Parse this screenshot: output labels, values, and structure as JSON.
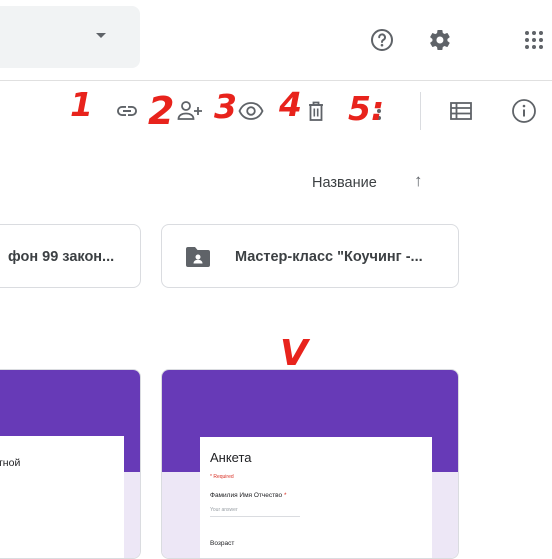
{
  "header": {
    "help_icon": "help-circle-icon",
    "settings_icon": "gear-icon",
    "apps_icon": "apps-grid-icon"
  },
  "toolbar": {
    "link_icon": "link-icon",
    "add_person_icon": "person-add-icon",
    "preview_icon": "eye-icon",
    "delete_icon": "trash-icon",
    "more_icon": "more-vert-icon",
    "list_view_icon": "list-view-icon",
    "info_icon": "info-icon"
  },
  "annotations": [
    "1",
    "2",
    "3",
    "4",
    "5:",
    "V"
  ],
  "sort": {
    "label": "Название",
    "arrow": "↑"
  },
  "folders": [
    {
      "title": "фон 99 закон..."
    },
    {
      "title": "Мастер-класс \"Коучинг -..."
    }
  ],
  "forms": [
    {
      "snippet": "тной"
    },
    {
      "title": "Анкета",
      "required_note": "* Required",
      "question": "Фамилия Имя Отчество",
      "placeholder": "Your answer",
      "question2": "Возраст"
    }
  ],
  "colors": {
    "accent": "#673ab7",
    "annotation": "#e8231c"
  }
}
